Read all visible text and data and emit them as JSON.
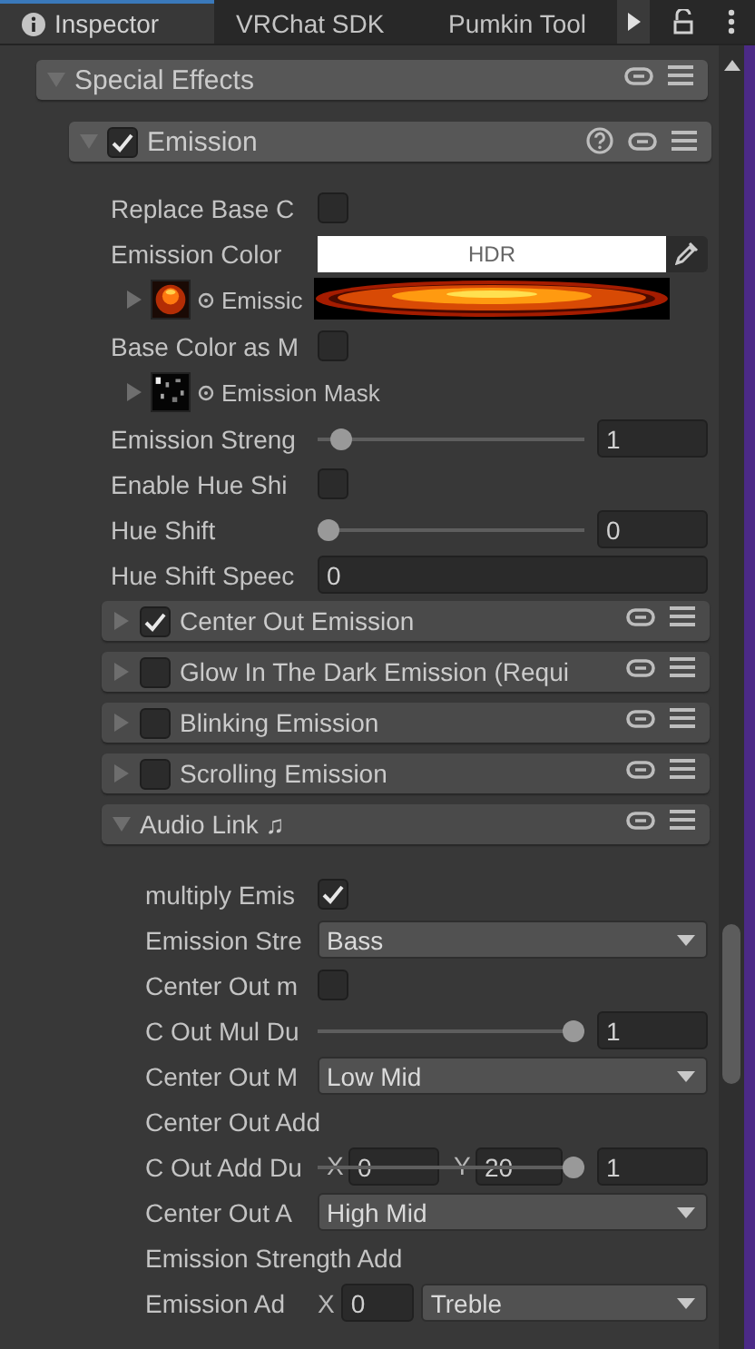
{
  "tabs": [
    {
      "label": "Inspector",
      "selected": true,
      "kind": "info"
    },
    {
      "label": "VRChat SDK",
      "selected": false,
      "kind": "plain"
    },
    {
      "label": "Pumkin Tool",
      "selected": false,
      "kind": "plain"
    }
  ],
  "special_effects": {
    "title": "Special Effects",
    "expanded": true,
    "emission": {
      "title": "Emission",
      "enabled": true,
      "expanded": true,
      "properties": [
        {
          "kind": "checkbox",
          "label": "Replace Base C",
          "checked": false
        },
        {
          "kind": "color",
          "label": "Emission Color",
          "value": "HDR"
        },
        {
          "kind": "texture_gradient",
          "label": "Emissic",
          "expanded": false
        },
        {
          "kind": "checkbox",
          "label": "Base Color as M",
          "checked": false
        },
        {
          "kind": "texture_mask",
          "label": "Emission Mask",
          "expanded": false
        },
        {
          "kind": "slider",
          "label": "Emission Streng",
          "level": 0.05,
          "value": "1"
        },
        {
          "kind": "checkbox",
          "label": "Enable Hue Shi",
          "checked": false
        },
        {
          "kind": "slider",
          "label": "Hue Shift",
          "level": 0,
          "value": "0"
        },
        {
          "kind": "number",
          "label": "Hue Shift Speec",
          "value": "0"
        }
      ]
    },
    "subsections": [
      {
        "title": "Center Out Emission",
        "enabled": true,
        "expanded": false
      },
      {
        "title": "Glow In The Dark Emission (Requi",
        "enabled": false,
        "expanded": false
      },
      {
        "title": "Blinking Emission",
        "enabled": false,
        "expanded": false
      },
      {
        "title": "Scrolling Emission",
        "enabled": false,
        "expanded": false
      }
    ],
    "audio_link": {
      "title": "Audio Link ♫",
      "expanded": true,
      "properties": [
        {
          "kind": "checkbox",
          "label": "multiply Emis",
          "checked": true
        },
        {
          "kind": "dropdown",
          "label": "Emission Stre",
          "value": "Bass"
        },
        {
          "kind": "checkbox",
          "label": "Center Out m",
          "checked": false
        },
        {
          "kind": "slider",
          "label": "C Out Mul Du",
          "level": 1,
          "value": "1"
        },
        {
          "kind": "dropdown",
          "label": "Center Out M",
          "value": "Low Mid"
        },
        {
          "kind": "heading",
          "label": "Center Out Add"
        },
        {
          "kind": "slider_over_vector",
          "label": "C Out Add Du",
          "level": 1,
          "value": "1",
          "x_label": "X",
          "x_value": "0",
          "y_label": "Y",
          "y_value": "20"
        },
        {
          "kind": "dropdown",
          "label": "Center Out A",
          "value": "High Mid"
        },
        {
          "kind": "heading",
          "label": "Emission Strength Add"
        },
        {
          "kind": "dropdown_over_vector",
          "label": "Emission Ad",
          "value": "Treble",
          "x_label": "X",
          "x_value": "0"
        }
      ]
    }
  }
}
